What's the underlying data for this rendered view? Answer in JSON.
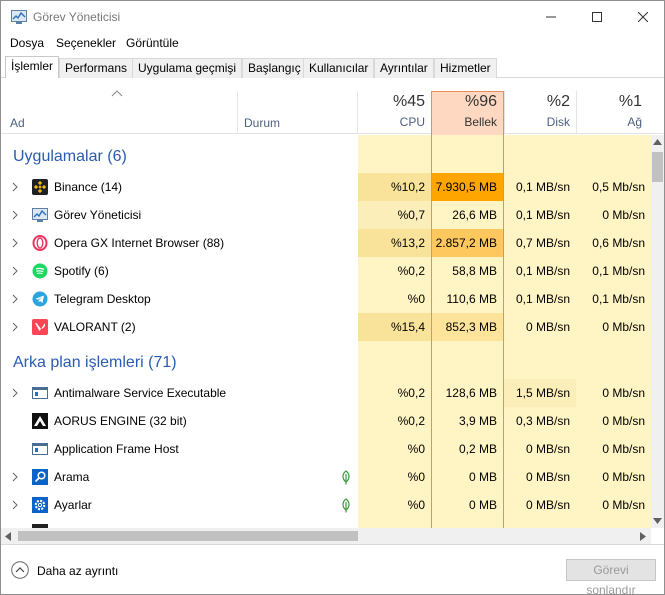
{
  "window": {
    "title": "Görev Yöneticisi"
  },
  "menu": [
    "Dosya",
    "Seçenekler",
    "Görüntüle"
  ],
  "tabs": [
    "İşlemler",
    "Performans",
    "Uygulama geçmişi",
    "Başlangıç",
    "Kullanıcılar",
    "Ayrıntılar",
    "Hizmetler"
  ],
  "columns": {
    "name": "Ad",
    "status": "Durum",
    "cpu": {
      "pct": "%45",
      "label": "CPU"
    },
    "memory": {
      "pct": "%96",
      "label": "Bellek"
    },
    "disk": {
      "pct": "%2",
      "label": "Disk"
    },
    "network": {
      "pct": "%1",
      "label": "Ağ"
    }
  },
  "groups": {
    "apps": "Uygulamalar (6)",
    "background": "Arka plan işlemleri (71)"
  },
  "apps": [
    {
      "name": "Binance (14)",
      "icon": "binance-icon",
      "cpu": "%10,2",
      "mem": "7.930,5 MB",
      "disk": "0,1 MB/sn",
      "net": "0,5 Mb/sn"
    },
    {
      "name": "Görev Yöneticisi",
      "icon": "task-manager-icon",
      "cpu": "%0,7",
      "mem": "26,6 MB",
      "disk": "0,1 MB/sn",
      "net": "0 Mb/sn"
    },
    {
      "name": "Opera GX Internet Browser (88)",
      "icon": "opera-gx-icon",
      "cpu": "%13,2",
      "mem": "2.857,2 MB",
      "disk": "0,7 MB/sn",
      "net": "0,6 Mb/sn"
    },
    {
      "name": "Spotify (6)",
      "icon": "spotify-icon",
      "cpu": "%0,2",
      "mem": "58,8 MB",
      "disk": "0,1 MB/sn",
      "net": "0,1 Mb/sn"
    },
    {
      "name": "Telegram Desktop",
      "icon": "telegram-icon",
      "cpu": "%0",
      "mem": "110,6 MB",
      "disk": "0,1 MB/sn",
      "net": "0,1 Mb/sn"
    },
    {
      "name": "VALORANT (2)",
      "icon": "valorant-icon",
      "cpu": "%15,4",
      "mem": "852,3 MB",
      "disk": "0 MB/sn",
      "net": "0 Mb/sn"
    }
  ],
  "background": [
    {
      "name": "Antimalware Service Executable",
      "icon": "service-window-icon",
      "cpu": "%0,2",
      "mem": "128,6 MB",
      "disk": "1,5 MB/sn",
      "net": "0 Mb/sn"
    },
    {
      "name": "AORUS ENGINE (32 bit)",
      "icon": "aorus-icon",
      "cpu": "%0,2",
      "mem": "3,9 MB",
      "disk": "0,3 MB/sn",
      "net": "0 Mb/sn"
    },
    {
      "name": "Application Frame Host",
      "icon": "service-window-icon",
      "cpu": "%0",
      "mem": "0,2 MB",
      "disk": "0 MB/sn",
      "net": "0 Mb/sn"
    },
    {
      "name": "Arama",
      "icon": "search-app-icon",
      "cpu": "%0",
      "mem": "0 MB",
      "disk": "0 MB/sn",
      "net": "0 Mb/sn"
    },
    {
      "name": "Ayarlar",
      "icon": "settings-app-icon",
      "cpu": "%0",
      "mem": "0 MB",
      "disk": "0 MB/sn",
      "net": "0 Mb/sn"
    }
  ],
  "footer": {
    "fewer_details": "Daha az ayrıntı",
    "end_task": "Görevi sonlandır"
  },
  "colors": {
    "heat_light": "#fff4c4",
    "heat_mid": "#f9eca8",
    "heat_strong": "#ffd369",
    "heat_top": "#ffa500",
    "memory_border": "#e88d60",
    "group_text": "#2a5bb3"
  }
}
